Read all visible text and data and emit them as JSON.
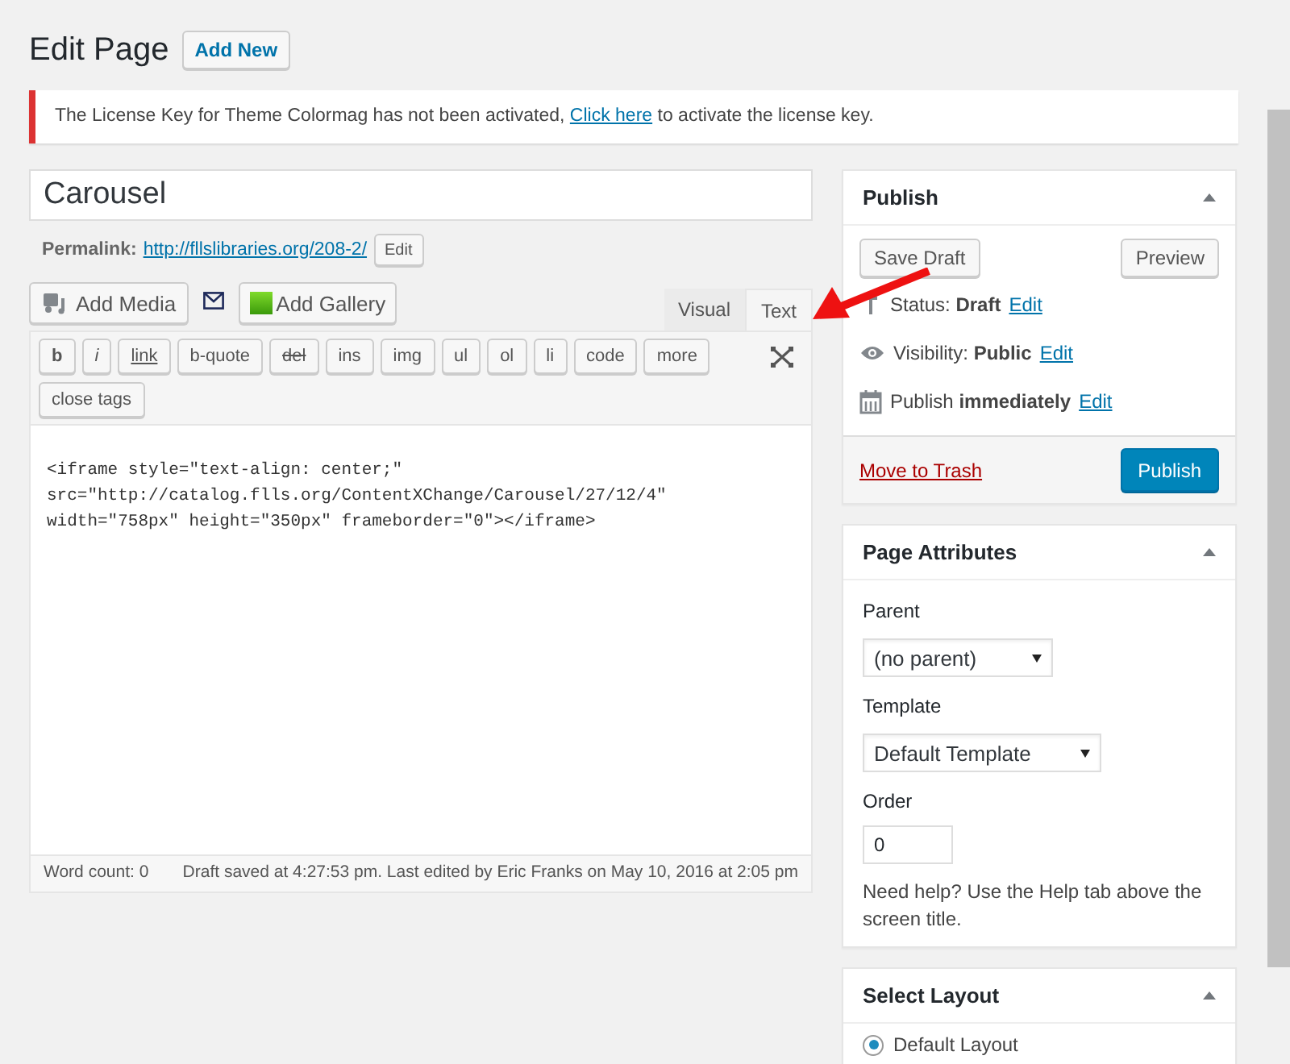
{
  "heading": {
    "title": "Edit Page",
    "add_new": "Add New"
  },
  "notice": {
    "before": "The License Key for Theme Colormag has not been activated,",
    "link": "Click here",
    "after": "to activate the license key."
  },
  "post_title": "Carousel",
  "permalink": {
    "label": "Permalink:",
    "url": "http://fllslibraries.org/208-2/",
    "edit": "Edit"
  },
  "media_buttons": [
    {
      "kind": "media",
      "label": "Add Media"
    },
    {
      "kind": "mail"
    },
    {
      "kind": "gallery",
      "label": "Add Gallery"
    }
  ],
  "editor_tabs": [
    {
      "label": "Visual",
      "selected": false
    },
    {
      "label": "Text",
      "selected": true
    }
  ],
  "quicktags": [
    {
      "label": "b",
      "kind": "bold"
    },
    {
      "label": "i",
      "kind": "italic"
    },
    {
      "label": "link",
      "kind": "link"
    },
    {
      "label": "b-quote",
      "kind": "plain"
    },
    {
      "label": "del",
      "kind": "del"
    },
    {
      "label": "ins",
      "kind": "plain"
    },
    {
      "label": "img",
      "kind": "plain"
    },
    {
      "label": "ul",
      "kind": "plain"
    },
    {
      "label": "ol",
      "kind": "plain"
    },
    {
      "label": "li",
      "kind": "plain"
    },
    {
      "label": "code",
      "kind": "plain"
    },
    {
      "label": "more",
      "kind": "plain"
    },
    {
      "label": "close tags",
      "kind": "plain"
    }
  ],
  "content_lines": [
    "<iframe style=\"text-align: center;\"",
    "src=\"http://catalog.flls.org/ContentXChange/Carousel/27/12/4\"",
    "width=\"758px\" height=\"350px\" frameborder=\"0\"></iframe>"
  ],
  "status_bar": {
    "word_count": "Word count: 0",
    "draft_saved": "Draft saved at 4:27:53 pm. Last edited by Eric Franks on May 10, 2016 at 2:05 pm"
  },
  "publish": {
    "title": "Publish",
    "save_draft": "Save Draft",
    "preview": "Preview",
    "rows": [
      {
        "kind": "status",
        "label": "Status:",
        "value": "Draft",
        "edit": "Edit"
      },
      {
        "kind": "visibility",
        "label": "Visibility:",
        "value": "Public",
        "edit": "Edit"
      },
      {
        "kind": "schedule",
        "label": "Publish",
        "value": "immediately",
        "edit": "Edit"
      }
    ],
    "trash": "Move to Trash",
    "publish": "Publish"
  },
  "page_attributes": {
    "title": "Page Attributes",
    "parent_label": "Parent",
    "parent_value": "(no parent)",
    "template_label": "Template",
    "template_value": "Default Template",
    "order_label": "Order",
    "order_value": "0",
    "help": "Need help? Use the Help tab above the screen title."
  },
  "select_layout": {
    "title": "Select Layout",
    "options": [
      {
        "label": "Default Layout",
        "selected": true
      }
    ]
  }
}
